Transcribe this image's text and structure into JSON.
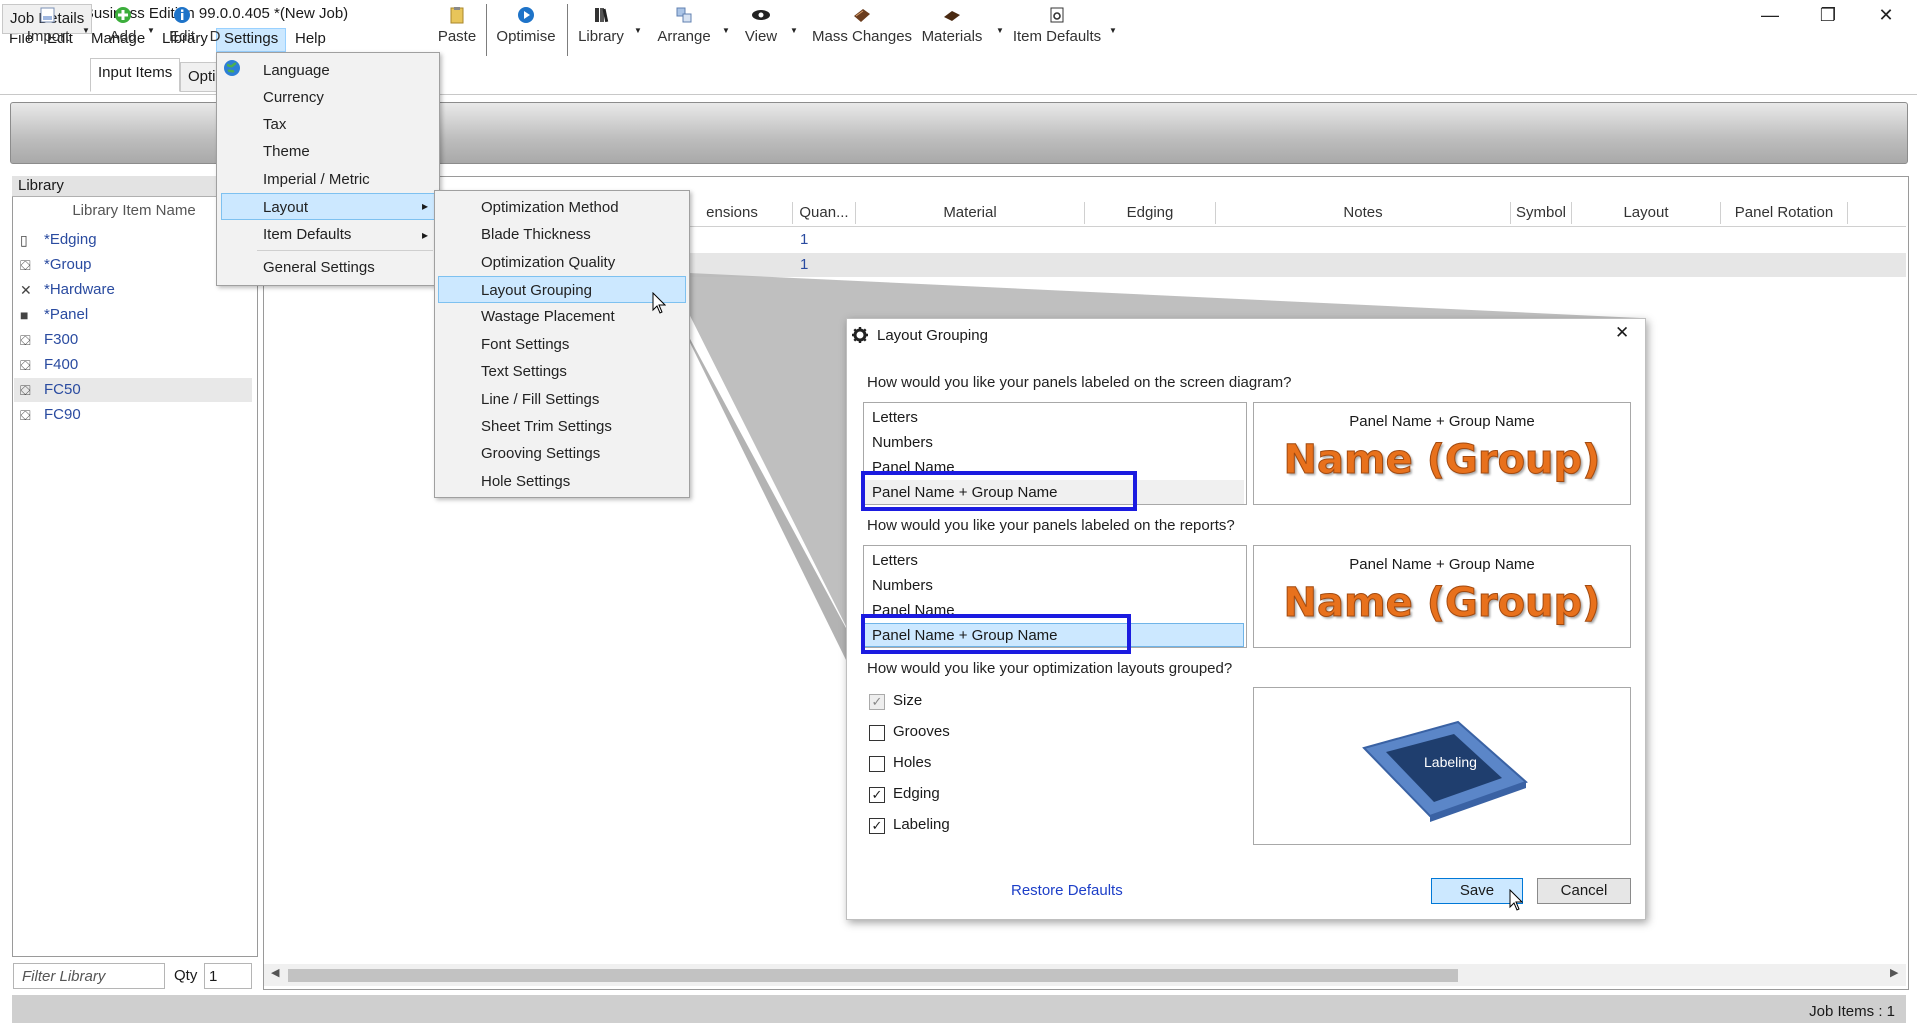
{
  "window": {
    "title": "MaxCut Business Edition 99.0.0.405 *(New Job)",
    "min_glyph": "—",
    "restore_glyph": "❐",
    "close_glyph": "✕"
  },
  "menubar": {
    "file": "File",
    "edit": "Edit",
    "manage": "Manage",
    "library": "Library",
    "settings": "Settings",
    "help": "Help"
  },
  "tabs": {
    "job_details": "Job Details",
    "input_items": "Input Items",
    "options_partial": "Opti"
  },
  "toolbar": {
    "import": "Import",
    "add": "Add",
    "edit": "Edit",
    "d_partial": "D",
    "paste": "Paste",
    "optimise": "Optimise",
    "library": "Library",
    "arrange": "Arrange",
    "view": "View",
    "mass_changes": "Mass Changes",
    "materials": "Materials",
    "item_defaults": "Item Defaults"
  },
  "library": {
    "title": "Library",
    "column": "Library Item Name",
    "items": [
      {
        "name": "*Edging",
        "icon": "edging-icon"
      },
      {
        "name": "*Group",
        "icon": "group-icon"
      },
      {
        "name": "*Hardware",
        "icon": "hardware-icon"
      },
      {
        "name": "*Panel",
        "icon": "panel-icon"
      },
      {
        "name": "F300",
        "icon": "group-icon"
      },
      {
        "name": "F400",
        "icon": "group-icon"
      },
      {
        "name": "FC50",
        "icon": "group-icon"
      },
      {
        "name": "FC90",
        "icon": "group-icon"
      }
    ],
    "filter_placeholder": "Filter Library",
    "qty_label": "Qty",
    "qty_value": "1"
  },
  "grid": {
    "columns": [
      "ensions",
      "Quan...",
      "Material",
      "Edging",
      "Notes",
      "Symbol",
      "Layout",
      "Panel Rotation"
    ],
    "rows": [
      {
        "quantity": "1"
      },
      {
        "quantity": "1"
      }
    ]
  },
  "status": {
    "job_items": "Job Items :  1"
  },
  "settings_menu": {
    "items": [
      "Language",
      "Currency",
      "Tax",
      "Theme",
      "Imperial / Metric",
      "Layout",
      "Item Defaults",
      "General Settings"
    ],
    "submenu_arrow": "▸"
  },
  "layout_submenu": {
    "items": [
      "Optimization Method",
      "Blade Thickness",
      "Optimization Quality",
      "Layout Grouping",
      "Wastage Placement",
      "Font Settings",
      "Text Settings",
      "Line / Fill Settings",
      "Sheet Trim Settings",
      "Grooving Settings",
      "Hole Settings"
    ],
    "highlighted": "Layout Grouping"
  },
  "dialog": {
    "title": "Layout Grouping",
    "q1": "How would you like your panels labeled on the screen diagram?",
    "q2": "How would you like your panels labeled on the reports?",
    "q3": "How would you like your optimization layouts grouped?",
    "screen_options": [
      "Letters",
      "Numbers",
      "Panel Name",
      "Panel Name + Group Name"
    ],
    "screen_selected": "Panel Name + Group Name",
    "report_options": [
      "Letters",
      "Numbers",
      "Panel Name",
      "Panel Name + Group Name"
    ],
    "report_selected": "Panel Name + Group Name",
    "preview_caption": "Panel Name + Group Name",
    "preview_big": "Name (Group)",
    "report_preview_caption": "Panel Name + Group Name",
    "report_preview_big": "Name (Group)",
    "grouping": [
      {
        "label": "Size",
        "checked": true,
        "disabled": true
      },
      {
        "label": "Grooves",
        "checked": false,
        "disabled": false
      },
      {
        "label": "Holes",
        "checked": false,
        "disabled": false
      },
      {
        "label": "Edging",
        "checked": true,
        "disabled": false
      },
      {
        "label": "Labeling",
        "checked": true,
        "disabled": false
      }
    ],
    "grouping_preview_label": "Labeling",
    "restore_defaults": "Restore Defaults",
    "save": "Save",
    "cancel": "Cancel",
    "checkmark": "✓",
    "close_glyph": "✕"
  },
  "colors": {
    "accent_blue": "#1b1be0",
    "selection": "#cce8ff",
    "link": "#1d3fc8",
    "preview_orange": "#e8711c"
  }
}
